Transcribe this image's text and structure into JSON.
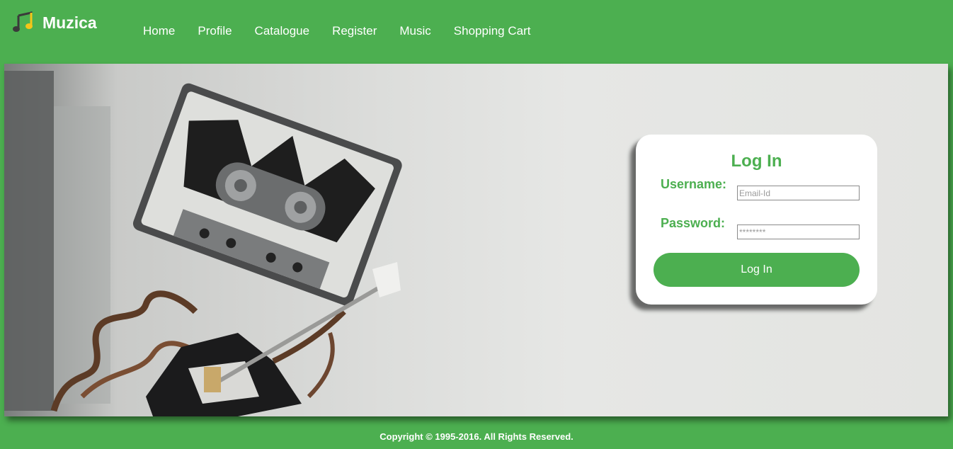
{
  "brand": {
    "name": "Muzica",
    "icon": "music-note-icon"
  },
  "nav": {
    "items": [
      {
        "label": "Home"
      },
      {
        "label": "Profile"
      },
      {
        "label": "Catalogue"
      },
      {
        "label": "Register"
      },
      {
        "label": "Music"
      },
      {
        "label": "Shopping Cart"
      }
    ]
  },
  "hero": {
    "image": "cassette-robot-guitar-image"
  },
  "login": {
    "title": "Log In",
    "username_label": "Username:",
    "username_placeholder": "Email-Id",
    "password_label": "Password:",
    "password_placeholder": "********",
    "button_label": "Log In"
  },
  "footer": {
    "copyright": "Copyright © 1995-2016. All Rights Reserved."
  },
  "colors": {
    "accent": "#4caf50",
    "card": "#ffffff"
  }
}
